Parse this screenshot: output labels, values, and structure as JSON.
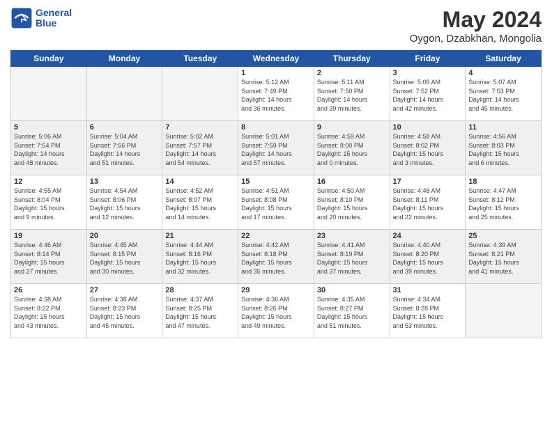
{
  "logo": {
    "line1": "General",
    "line2": "Blue"
  },
  "title": "May 2024",
  "subtitle": "Oygon, Dzabkhan, Mongolia",
  "days_of_week": [
    "Sunday",
    "Monday",
    "Tuesday",
    "Wednesday",
    "Thursday",
    "Friday",
    "Saturday"
  ],
  "weeks": [
    [
      {
        "day": "",
        "info": "",
        "empty": true
      },
      {
        "day": "",
        "info": "",
        "empty": true
      },
      {
        "day": "",
        "info": "",
        "empty": true
      },
      {
        "day": "1",
        "info": "Sunrise: 5:12 AM\nSunset: 7:49 PM\nDaylight: 14 hours\nand 36 minutes."
      },
      {
        "day": "2",
        "info": "Sunrise: 5:11 AM\nSunset: 7:50 PM\nDaylight: 14 hours\nand 39 minutes."
      },
      {
        "day": "3",
        "info": "Sunrise: 5:09 AM\nSunset: 7:52 PM\nDaylight: 14 hours\nand 42 minutes."
      },
      {
        "day": "4",
        "info": "Sunrise: 5:07 AM\nSunset: 7:53 PM\nDaylight: 14 hours\nand 45 minutes."
      }
    ],
    [
      {
        "day": "5",
        "info": "Sunrise: 5:06 AM\nSunset: 7:54 PM\nDaylight: 14 hours\nand 48 minutes.",
        "shaded": true
      },
      {
        "day": "6",
        "info": "Sunrise: 5:04 AM\nSunset: 7:56 PM\nDaylight: 14 hours\nand 51 minutes.",
        "shaded": true
      },
      {
        "day": "7",
        "info": "Sunrise: 5:02 AM\nSunset: 7:57 PM\nDaylight: 14 hours\nand 54 minutes.",
        "shaded": true
      },
      {
        "day": "8",
        "info": "Sunrise: 5:01 AM\nSunset: 7:59 PM\nDaylight: 14 hours\nand 57 minutes.",
        "shaded": true
      },
      {
        "day": "9",
        "info": "Sunrise: 4:59 AM\nSunset: 8:00 PM\nDaylight: 15 hours\nand 0 minutes.",
        "shaded": true
      },
      {
        "day": "10",
        "info": "Sunrise: 4:58 AM\nSunset: 8:02 PM\nDaylight: 15 hours\nand 3 minutes.",
        "shaded": true
      },
      {
        "day": "11",
        "info": "Sunrise: 4:56 AM\nSunset: 8:03 PM\nDaylight: 15 hours\nand 6 minutes.",
        "shaded": true
      }
    ],
    [
      {
        "day": "12",
        "info": "Sunrise: 4:55 AM\nSunset: 8:04 PM\nDaylight: 15 hours\nand 9 minutes."
      },
      {
        "day": "13",
        "info": "Sunrise: 4:54 AM\nSunset: 8:06 PM\nDaylight: 15 hours\nand 12 minutes."
      },
      {
        "day": "14",
        "info": "Sunrise: 4:52 AM\nSunset: 8:07 PM\nDaylight: 15 hours\nand 14 minutes."
      },
      {
        "day": "15",
        "info": "Sunrise: 4:51 AM\nSunset: 8:08 PM\nDaylight: 15 hours\nand 17 minutes."
      },
      {
        "day": "16",
        "info": "Sunrise: 4:50 AM\nSunset: 8:10 PM\nDaylight: 15 hours\nand 20 minutes."
      },
      {
        "day": "17",
        "info": "Sunrise: 4:48 AM\nSunset: 8:11 PM\nDaylight: 15 hours\nand 22 minutes."
      },
      {
        "day": "18",
        "info": "Sunrise: 4:47 AM\nSunset: 8:12 PM\nDaylight: 15 hours\nand 25 minutes."
      }
    ],
    [
      {
        "day": "19",
        "info": "Sunrise: 4:46 AM\nSunset: 8:14 PM\nDaylight: 15 hours\nand 27 minutes.",
        "shaded": true
      },
      {
        "day": "20",
        "info": "Sunrise: 4:45 AM\nSunset: 8:15 PM\nDaylight: 15 hours\nand 30 minutes.",
        "shaded": true
      },
      {
        "day": "21",
        "info": "Sunrise: 4:44 AM\nSunset: 8:16 PM\nDaylight: 15 hours\nand 32 minutes.",
        "shaded": true
      },
      {
        "day": "22",
        "info": "Sunrise: 4:42 AM\nSunset: 8:18 PM\nDaylight: 15 hours\nand 35 minutes.",
        "shaded": true
      },
      {
        "day": "23",
        "info": "Sunrise: 4:41 AM\nSunset: 8:19 PM\nDaylight: 15 hours\nand 37 minutes.",
        "shaded": true
      },
      {
        "day": "24",
        "info": "Sunrise: 4:40 AM\nSunset: 8:20 PM\nDaylight: 15 hours\nand 39 minutes.",
        "shaded": true
      },
      {
        "day": "25",
        "info": "Sunrise: 4:39 AM\nSunset: 8:21 PM\nDaylight: 15 hours\nand 41 minutes.",
        "shaded": true
      }
    ],
    [
      {
        "day": "26",
        "info": "Sunrise: 4:38 AM\nSunset: 8:22 PM\nDaylight: 15 hours\nand 43 minutes."
      },
      {
        "day": "27",
        "info": "Sunrise: 4:38 AM\nSunset: 8:23 PM\nDaylight: 15 hours\nand 45 minutes."
      },
      {
        "day": "28",
        "info": "Sunrise: 4:37 AM\nSunset: 8:25 PM\nDaylight: 15 hours\nand 47 minutes."
      },
      {
        "day": "29",
        "info": "Sunrise: 4:36 AM\nSunset: 8:26 PM\nDaylight: 15 hours\nand 49 minutes."
      },
      {
        "day": "30",
        "info": "Sunrise: 4:35 AM\nSunset: 8:27 PM\nDaylight: 15 hours\nand 51 minutes."
      },
      {
        "day": "31",
        "info": "Sunrise: 4:34 AM\nSunset: 8:28 PM\nDaylight: 15 hours\nand 53 minutes."
      },
      {
        "day": "",
        "info": "",
        "empty": true
      }
    ]
  ]
}
